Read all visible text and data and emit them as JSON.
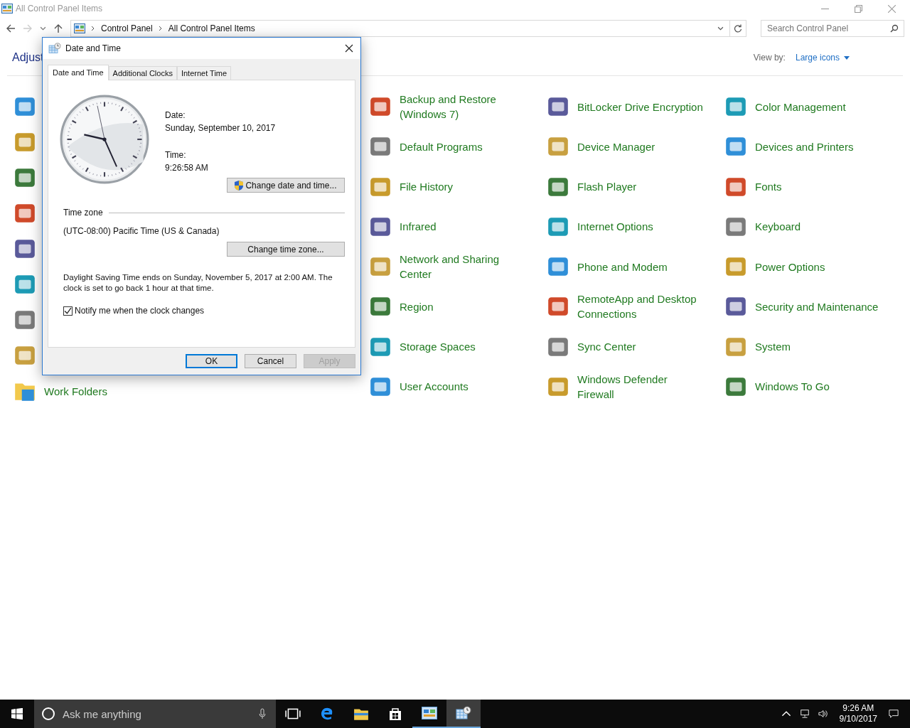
{
  "window": {
    "title": "All Control Panel Items",
    "active": false
  },
  "address": {
    "crumbs": [
      "Control Panel",
      "All Control Panel Items"
    ]
  },
  "search": {
    "placeholder": "Search Control Panel"
  },
  "heading": "Adjust",
  "view_by": {
    "label": "View by:",
    "value": "Large icons"
  },
  "first_column": [
    {
      "kind": "icon"
    },
    {
      "kind": "icon"
    },
    {
      "kind": "icon"
    },
    {
      "kind": "icon"
    },
    {
      "kind": "icon"
    },
    {
      "kind": "icon"
    },
    {
      "kind": "icon"
    },
    {
      "kind": "icon"
    },
    {
      "kind": "link",
      "label": "Work Folders"
    }
  ],
  "items": [
    {
      "label": "Backup and Restore (Windows 7)"
    },
    {
      "label": "BitLocker Drive Encryption"
    },
    {
      "label": "Color Management"
    },
    {
      "label": "Default Programs"
    },
    {
      "label": "Device Manager"
    },
    {
      "label": "Devices and Printers"
    },
    {
      "label": "File History"
    },
    {
      "label": "Flash Player"
    },
    {
      "label": "Fonts"
    },
    {
      "label": "Infrared"
    },
    {
      "label": "Internet Options"
    },
    {
      "label": "Keyboard"
    },
    {
      "label": "Network and Sharing Center"
    },
    {
      "label": "Phone and Modem"
    },
    {
      "label": "Power Options"
    },
    {
      "label": "Region"
    },
    {
      "label": "RemoteApp and Desktop Connections"
    },
    {
      "label": "Security and Maintenance"
    },
    {
      "label": "Storage Spaces"
    },
    {
      "label": "Sync Center"
    },
    {
      "label": "System"
    },
    {
      "label": "User Accounts"
    },
    {
      "label": "Windows Defender Firewall"
    },
    {
      "label": "Windows To Go"
    }
  ],
  "dialog": {
    "title": "Date and Time",
    "tabs": [
      {
        "label": "Date and Time",
        "selected": true
      },
      {
        "label": "Additional Clocks",
        "selected": false
      },
      {
        "label": "Internet Time",
        "selected": false
      }
    ],
    "date_label": "Date:",
    "date": "Sunday, September 10, 2017",
    "time_label": "Time:",
    "time": "9:26:58 AM",
    "change_datetime_button": "Change date and time...",
    "time_zone_heading": "Time zone",
    "time_zone": "(UTC-08:00) Pacific Time (US & Canada)",
    "change_zone_button": "Change time zone...",
    "dst_note": "Daylight Saving Time ends on Sunday, November 5, 2017 at 2:00 AM. The clock is set to go back 1 hour at that time.",
    "notify": {
      "label": "Notify me when the clock changes",
      "checked": true
    },
    "buttons": [
      {
        "label": "OK",
        "default": true,
        "disabled": false
      },
      {
        "label": "Cancel",
        "default": false,
        "disabled": false
      },
      {
        "label": "Apply",
        "default": false,
        "disabled": true
      }
    ]
  },
  "taskbar": {
    "search_placeholder": "Ask me anything",
    "apps": [
      {
        "kind": "task-view",
        "open": false,
        "selected": false
      },
      {
        "kind": "browser",
        "open": false,
        "selected": false
      },
      {
        "kind": "folder",
        "open": false,
        "selected": false
      },
      {
        "kind": "store",
        "open": false,
        "selected": false
      },
      {
        "kind": "control-panel",
        "open": true,
        "selected": false
      },
      {
        "kind": "clock",
        "open": true,
        "selected": true
      }
    ],
    "time": "9:26 AM",
    "date": "9/10/2017"
  }
}
